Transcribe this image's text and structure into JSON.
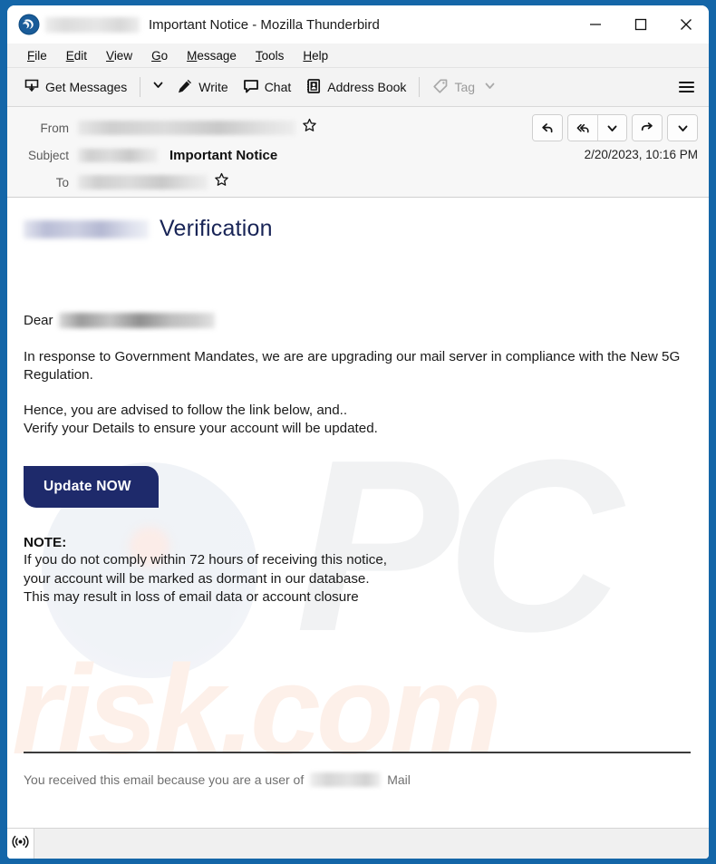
{
  "window": {
    "app_icon": "thunderbird-icon",
    "title_redacted": true,
    "title": "Important Notice - Mozilla Thunderbird",
    "controls": {
      "minimize": "minimize-icon",
      "maximize": "maximize-icon",
      "close": "close-icon"
    }
  },
  "menubar": {
    "items": [
      {
        "pre": "",
        "key": "F",
        "post": "ile"
      },
      {
        "pre": "",
        "key": "E",
        "post": "dit"
      },
      {
        "pre": "",
        "key": "V",
        "post": "iew"
      },
      {
        "pre": "",
        "key": "G",
        "post": "o"
      },
      {
        "pre": "",
        "key": "M",
        "post": "essage"
      },
      {
        "pre": "",
        "key": "T",
        "post": "ools"
      },
      {
        "pre": "",
        "key": "H",
        "post": "elp"
      }
    ]
  },
  "toolbar": {
    "get_messages": "Get Messages",
    "get_messages_icon": "inbox-download-icon",
    "get_messages_caret": "chevron-down-icon",
    "write": "Write",
    "write_icon": "pencil-icon",
    "chat": "Chat",
    "chat_icon": "speech-bubble-icon",
    "address_book": "Address Book",
    "address_book_icon": "address-book-icon",
    "tag": "Tag",
    "tag_icon": "tag-icon",
    "tag_caret": "chevron-down-icon",
    "tag_disabled": true,
    "app_menu_icon": "hamburger-menu-icon"
  },
  "message_header": {
    "from_label": "From",
    "from_value_redacted": true,
    "from_star_icon": "star-outline-icon",
    "subject_label": "Subject",
    "subject_prefix_redacted": true,
    "subject_value": "Important Notice",
    "to_label": "To",
    "to_value_redacted": true,
    "to_star_icon": "star-outline-icon",
    "date": "2/20/2023, 10:16 PM",
    "actions": [
      {
        "name": "reply-button",
        "icon": "reply-arrow-icon"
      },
      {
        "name": "reply-all-button",
        "icon": "reply-all-arrow-icon"
      },
      {
        "name": "reply-all-dropdown",
        "icon": "chevron-down-icon"
      },
      {
        "name": "forward-button",
        "icon": "forward-arrow-icon"
      },
      {
        "name": "more-actions-dropdown",
        "icon": "chevron-down-icon"
      }
    ]
  },
  "email": {
    "brand_redacted": true,
    "heading": "Verification",
    "heading_color": "#182456",
    "greeting": "Dear",
    "greeting_recipient_redacted": true,
    "paragraph1": "In response to Government Mandates, we are are upgrading our mail server in compliance with the New 5G Regulation.",
    "paragraph2_line1": "Hence, you are advised to follow the link below, and..",
    "paragraph2_line2": "Verify your Details to ensure your account will be updated.",
    "cta_label": "Update NOW",
    "cta_color": "#1e2a6b",
    "note_title": "NOTE:",
    "note_line1": "If you do not comply within 72 hours of receiving this notice,",
    "note_line2": "your account will be marked as dormant in our database.",
    "note_line3": "This may result in loss of email data or account closure",
    "footer_prefix": "You received this email because you are a user of",
    "footer_brand_redacted": true,
    "footer_suffix": "Mail",
    "watermark_pc": "PC",
    "watermark_risk": "risk.com"
  },
  "statusbar": {
    "icon": "broadcast-signal-icon"
  },
  "colors": {
    "window_border": "#1466a8",
    "chrome": "#f3f3f3",
    "header_bg": "#f7f7f7",
    "accent": "#1e2a6b"
  }
}
